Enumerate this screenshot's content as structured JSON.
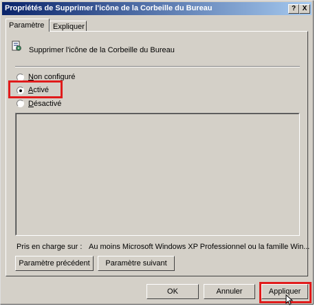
{
  "window": {
    "title": "Propriétés de Supprimer l'icône de la Corbeille du Bureau",
    "help_glyph": "?",
    "close_glyph": "X"
  },
  "tabs": [
    {
      "label": "Paramètre",
      "selected": true
    },
    {
      "label": "Expliquer",
      "selected": false
    }
  ],
  "policy": {
    "name": "Supprimer l'icône de la Corbeille du Bureau",
    "icon": "policy-setting-icon"
  },
  "options": [
    {
      "prefix": "",
      "mnemonic": "N",
      "rest": "on configuré",
      "selected": false
    },
    {
      "prefix": "",
      "mnemonic": "A",
      "rest": "ctivé",
      "selected": true
    },
    {
      "prefix": "",
      "mnemonic": "D",
      "rest": "ésactivé",
      "selected": false
    }
  ],
  "supported": {
    "label": "Pris en charge sur :",
    "value": "Au moins Microsoft Windows XP Professionnel ou la famille Win..."
  },
  "nav": {
    "previous": "Paramètre précédent",
    "next": "Paramètre suivant"
  },
  "footer": {
    "ok": "OK",
    "cancel": "Annuler",
    "apply": "Appliquer"
  },
  "colors": {
    "highlight": "#e01a1a",
    "titlebar_start": "#0a246a",
    "titlebar_end": "#a6caf0",
    "face": "#d4d0c8"
  }
}
